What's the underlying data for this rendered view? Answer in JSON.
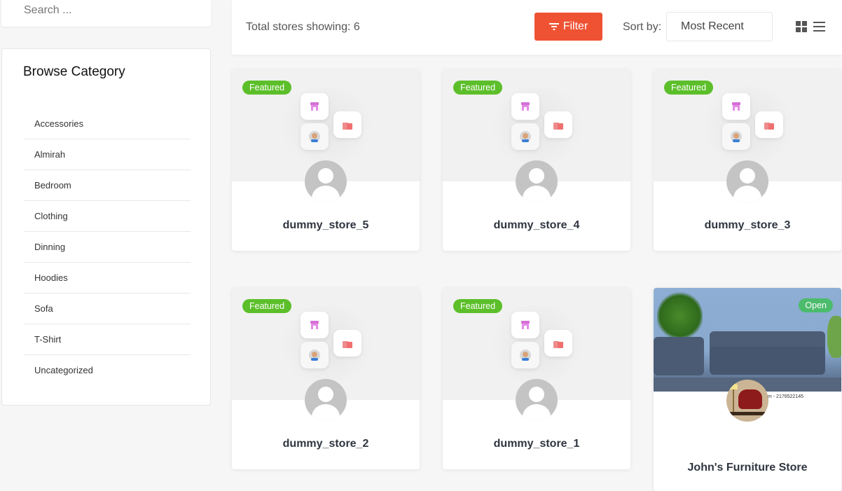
{
  "sidebar": {
    "search_placeholder": "Search ...",
    "browse_title": "Browse Category",
    "categories": [
      "Accessories",
      "Almirah",
      "Bedroom",
      "Clothing",
      "Dinning",
      "Hoodies",
      "Sofa",
      "T-Shirt",
      "Uncategorized"
    ]
  },
  "toolbar": {
    "total_label": "Total stores showing: 6",
    "filter_label": "Filter",
    "sort_label": "Sort by:",
    "sort_value": "Most Recent",
    "accent_color": "#ef5233"
  },
  "stores": [
    {
      "name": "dummy_store_5",
      "badge": "Featured"
    },
    {
      "name": "dummy_store_4",
      "badge": "Featured"
    },
    {
      "name": "dummy_store_3",
      "badge": "Featured"
    },
    {
      "name": "dummy_store_2",
      "badge": "Featured"
    },
    {
      "name": "dummy_store_1",
      "badge": "Featured"
    },
    {
      "name": "John's Furniture Store",
      "badge": "Open",
      "banner_text": "m - 2176522145"
    }
  ]
}
